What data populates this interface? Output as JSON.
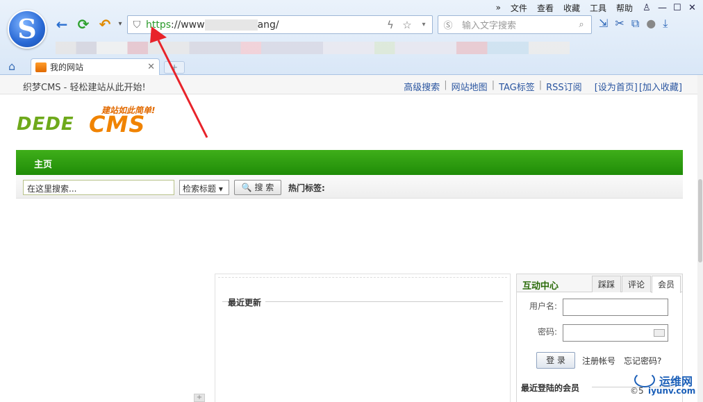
{
  "browser": {
    "menu": [
      "»",
      "文件",
      "查看",
      "收藏",
      "工具",
      "帮助"
    ],
    "url": {
      "scheme": "https",
      "rest": "://www",
      "tail": "ang/"
    },
    "search_placeholder": "输入文字搜索",
    "tab_title": "我的网站",
    "new_tab": "+"
  },
  "site": {
    "slogan": "织梦CMS - 轻松建站从此开始!",
    "top_links": [
      "高级搜索",
      "网站地图",
      "TAG标签",
      "RSS订阅"
    ],
    "set_home": "[设为首页]",
    "add_fav": "[加入收藏]",
    "logo": {
      "slogan": "建站如此简单!",
      "dede": "DEDE",
      "cms": "CMS"
    },
    "nav_home": "主页",
    "search": {
      "placeholder": "在这里搜索...",
      "select": "检索标题 ▾",
      "button": "🔍 搜 索",
      "hot_tags": "热门标签:"
    },
    "main_title": "最近更新",
    "side": {
      "title": "互动中心",
      "tabs": [
        "踩踩",
        "评论",
        "会员"
      ],
      "username_label": "用户名:",
      "password_label": "密码:",
      "login": "登 录",
      "register": "注册帐号",
      "forgot": "忘记密码?",
      "recent_members": "最近登陆的会员"
    },
    "watermark": {
      "brand": "运维网",
      "prefix": "©5",
      "domain": "iyunv.com"
    }
  },
  "colors": {
    "nav_green": "#1f8c07",
    "logo_green": "#6ea91b",
    "logo_orange": "#f08300",
    "arrow_red": "#e8232a"
  }
}
